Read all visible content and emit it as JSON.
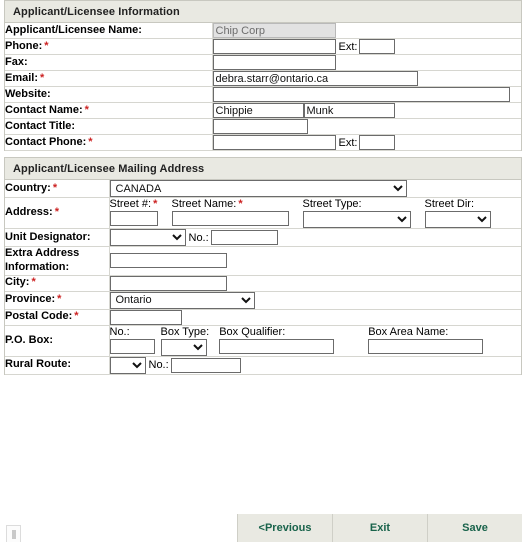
{
  "sections": {
    "info": {
      "title": "Applicant/Licensee Information",
      "rows": {
        "name": {
          "label": "Applicant/Licensee Name:",
          "required": false,
          "value": "Chip Corp",
          "disabled": true
        },
        "phone": {
          "label": "Phone:",
          "required": true,
          "value": "",
          "ext_label": "Ext:",
          "ext_value": ""
        },
        "fax": {
          "label": "Fax:",
          "required": false,
          "value": ""
        },
        "email": {
          "label": "Email:",
          "required": true,
          "value": "debra.starr@ontario.ca"
        },
        "website": {
          "label": "Website:",
          "required": false,
          "value": ""
        },
        "contact_name": {
          "label": "Contact Name:",
          "required": true,
          "first_value": "Chippie",
          "last_value": "Munk"
        },
        "contact_title": {
          "label": "Contact Title:",
          "required": false,
          "value": ""
        },
        "contact_phone": {
          "label": "Contact Phone:",
          "required": true,
          "value": "",
          "ext_label": "Ext:",
          "ext_value": ""
        }
      }
    },
    "address": {
      "title": "Applicant/Licensee Mailing Address",
      "rows": {
        "country": {
          "label": "Country:",
          "required": true,
          "value": "CANADA",
          "options": [
            "CANADA"
          ]
        },
        "address": {
          "label": "Address:",
          "required": true,
          "street_no_label": "Street #:",
          "street_no_required": true,
          "street_no_value": "",
          "street_name_label": "Street Name:",
          "street_name_required": true,
          "street_name_value": "",
          "street_type_label": "Street Type:",
          "street_type_value": "",
          "street_dir_label": "Street Dir:",
          "street_dir_value": ""
        },
        "unit": {
          "label": "Unit Designator:",
          "required": false,
          "designator_value": "",
          "no_label": "No.:",
          "no_value": ""
        },
        "extra": {
          "label": "Extra Address Information:",
          "required": false,
          "value": ""
        },
        "city": {
          "label": "City:",
          "required": true,
          "value": ""
        },
        "province": {
          "label": "Province:",
          "required": true,
          "value": "Ontario",
          "options": [
            "Ontario"
          ]
        },
        "postal": {
          "label": "Postal Code:",
          "required": true,
          "value": ""
        },
        "pobox": {
          "label": "P.O. Box:",
          "required": false,
          "no_label": "No.:",
          "no_value": "",
          "box_type_label": "Box Type:",
          "box_type_value": "",
          "box_qualifier_label": "Box Qualifier:",
          "box_qualifier_value": "",
          "box_area_label": "Box Area Name:",
          "box_area_value": ""
        },
        "rural": {
          "label": "Rural Route:",
          "required": false,
          "route_value": "",
          "no_label": "No.:",
          "no_value": ""
        }
      }
    }
  },
  "footer": {
    "previous_label": "<Previous",
    "exit_label": "Exit",
    "save_label": "Save"
  },
  "colors": {
    "section_header_bg": "#e9e9e2",
    "required_marker": "#cc2222",
    "button_text": "#19634b",
    "button_bg": "#e9e9e2"
  }
}
